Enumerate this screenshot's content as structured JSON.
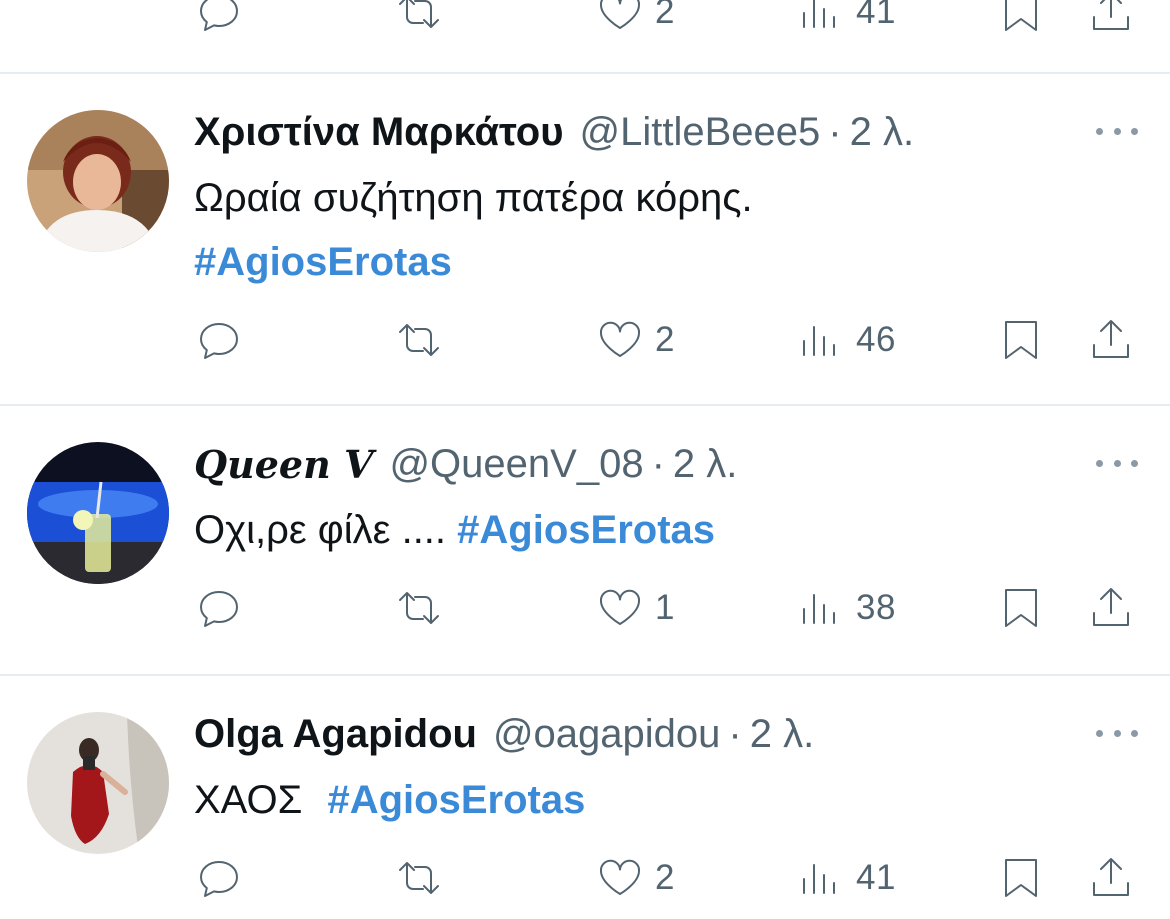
{
  "top_actions": {
    "likes": "2",
    "views": "41"
  },
  "tweets": [
    {
      "display_name": "Χριστίνα Μαρκάτου",
      "handle": "@LittleBeee5",
      "separator": "·",
      "time": "2 λ.",
      "text": "Ωραία συζήτηση πατέρα κόρης.",
      "hashtag": "#AgiosErotas",
      "likes": "2",
      "views": "46"
    },
    {
      "display_name": "𝑸𝒖𝒆𝒆𝒏 𝑽",
      "handle": "@QueenV_08",
      "separator": "·",
      "time": "2 λ.",
      "text": "Οχι,ρε φίλε ....",
      "hashtag": "#AgiosErotas",
      "likes": "1",
      "views": "38"
    },
    {
      "display_name": "Olga Agapidou",
      "handle": "@oagapidou",
      "separator": "·",
      "time": "2 λ.",
      "text": "ΧΑΟΣ",
      "hashtag": "#AgiosErotas",
      "likes": "2",
      "views": "41"
    }
  ],
  "icons": {
    "reply": "reply-icon",
    "retweet": "retweet-icon",
    "like": "heart-icon",
    "views": "views-icon",
    "bookmark": "bookmark-icon",
    "share": "share-icon",
    "more": "more-icon"
  },
  "colors": {
    "hashtag": "#3a8ad8",
    "secondary_text": "#536471",
    "divider": "#e6ecf0"
  }
}
